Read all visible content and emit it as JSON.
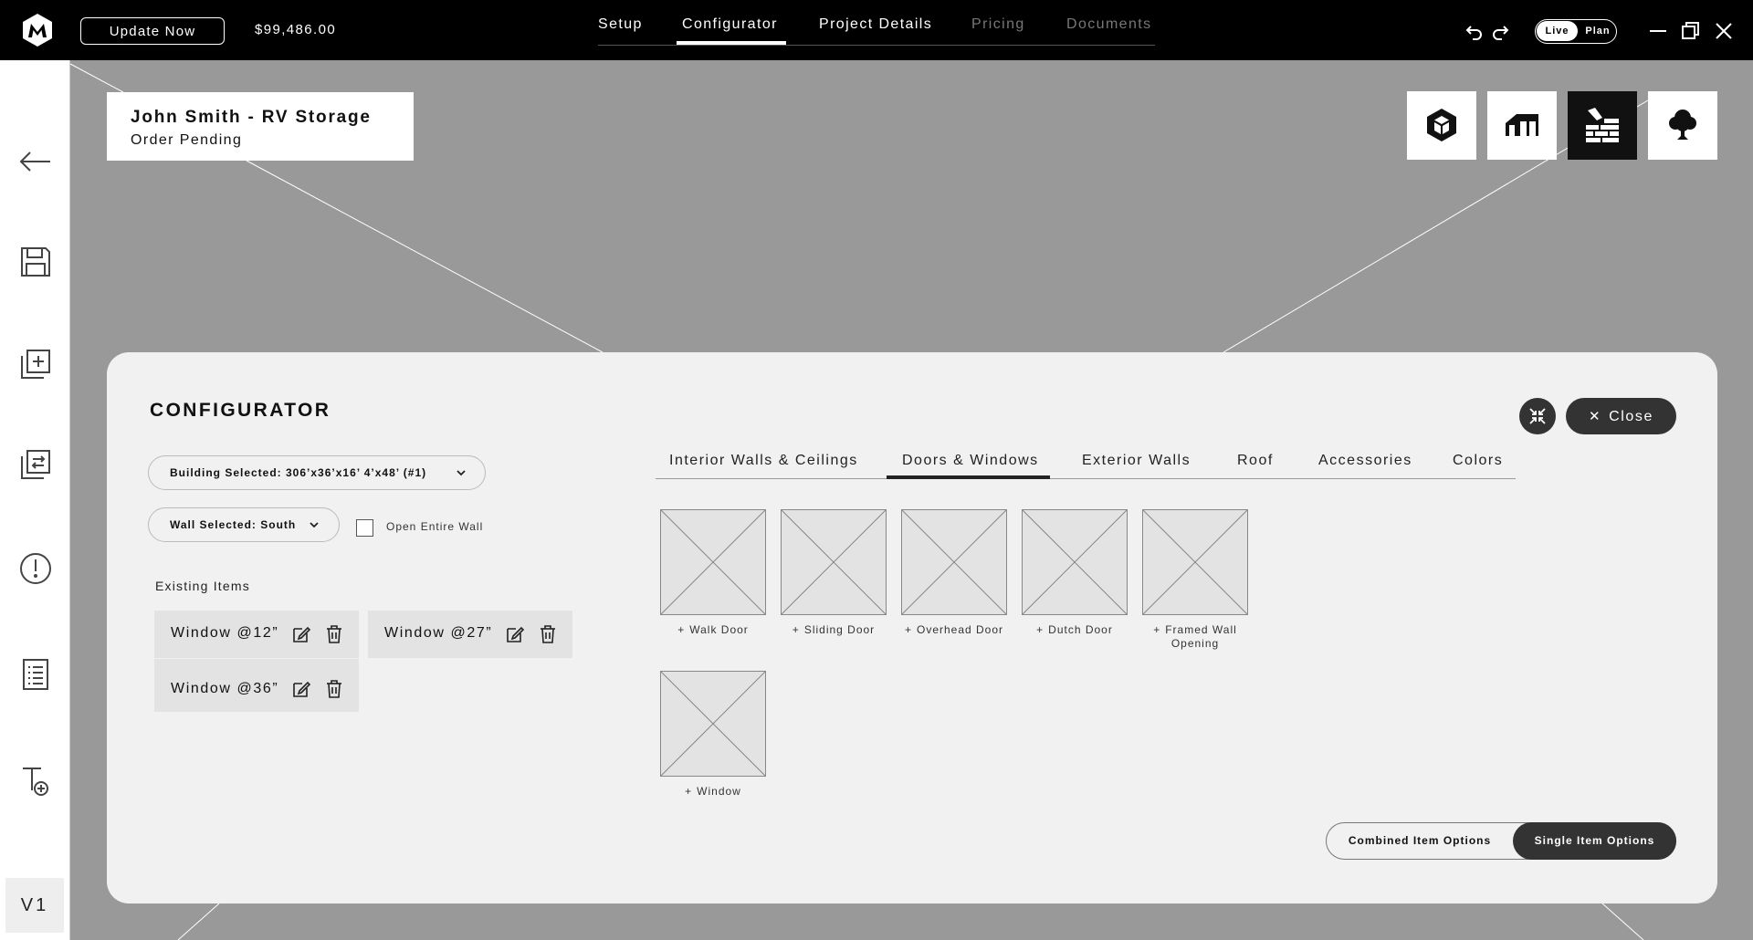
{
  "topbar": {
    "update_label": "Update Now",
    "price": "$99,486.00",
    "nav": [
      {
        "label": "Setup"
      },
      {
        "label": "Configurator"
      },
      {
        "label": "Project Details"
      },
      {
        "label": "Pricing"
      },
      {
        "label": "Documents"
      }
    ],
    "active_nav": "Configurator",
    "mode": {
      "live": "Live",
      "plan": "Plan",
      "selected": "Live"
    }
  },
  "sidebar": {
    "icons": [
      "back-arrow-icon",
      "save-icon",
      "add-layer-icon",
      "swap-icon",
      "alert-icon",
      "list-icon",
      "text-add-icon"
    ],
    "version": "V1"
  },
  "project": {
    "title": "John Smith - RV Storage",
    "status": "Order Pending"
  },
  "views": {
    "icons": [
      "3d-cube-icon",
      "building-icon",
      "wall-bricks-icon",
      "tree-icon"
    ],
    "active": "wall-bricks-icon"
  },
  "configurator": {
    "title": "CONFIGURATOR",
    "close_label": "Close",
    "building_select": "Building Selected: 306’x36’x16’ 4’x48’ (#1)",
    "wall_select": "Wall Selected: South",
    "open_wall_label": "Open Entire Wall",
    "open_wall_checked": false,
    "existing_label": "Existing Items",
    "existing_items": [
      {
        "label": "Window @12”"
      },
      {
        "label": "Window @27”"
      },
      {
        "label": "Window @36”"
      }
    ],
    "tabs": [
      {
        "label": "Interior Walls & Ceilings"
      },
      {
        "label": "Doors & Windows"
      },
      {
        "label": "Exterior Walls"
      },
      {
        "label": "Roof"
      },
      {
        "label": "Accessories"
      },
      {
        "label": "Colors"
      }
    ],
    "active_tab": "Doors & Windows",
    "tiles": [
      {
        "label": "Walk Door"
      },
      {
        "label": "Sliding Door"
      },
      {
        "label": "Overhead Door"
      },
      {
        "label": "Dutch Door"
      },
      {
        "label": "Framed Wall Opening"
      },
      {
        "label": "Window"
      }
    ],
    "options": {
      "combined": "Combined Item Options",
      "single": "Single Item Options",
      "selected": "Single Item Options"
    }
  },
  "colors": {
    "topbar_bg": "#000000",
    "canvas_bg": "#999999",
    "panel_bg": "#f1f1f1",
    "accent_dark": "#333333"
  }
}
